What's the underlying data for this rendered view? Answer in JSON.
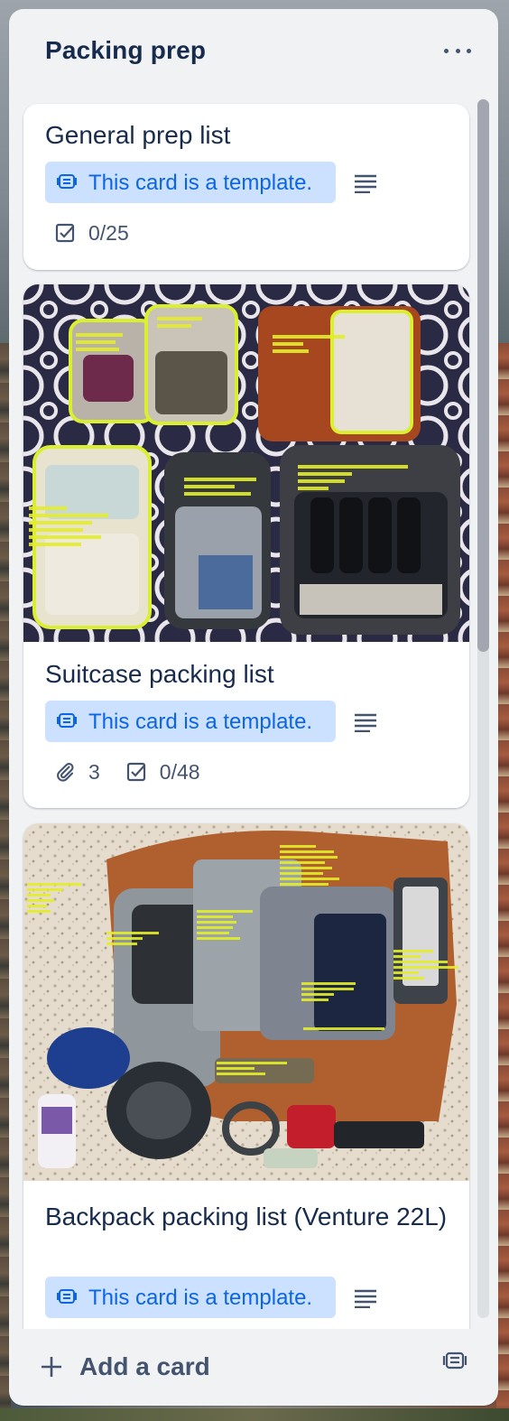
{
  "list": {
    "title": "Packing prep",
    "menu_icon": "more-horizontal-icon"
  },
  "cards": [
    {
      "title": "General prep list",
      "template_label": "This card is a template.",
      "checklist": "0/25"
    },
    {
      "title": "Suitcase packing list",
      "template_label": "This card is a template.",
      "attachments": "3",
      "checklist": "0/48",
      "cover": {
        "labels": [
          "M packing cube",
          "M compression cube",
          "L compression cube",
          "S compression cube (outerwear)",
          "M compression cube (skinwear)",
          "toiletries"
        ]
      }
    },
    {
      "title": "Backpack packing list (Venture 22L)",
      "template_label": "This card is a template.",
      "cover": {
        "labels": [
          "Main compartment",
          "Laptop sleeve",
          "side pocket (long items)",
          "zipped mesh pocket"
        ]
      }
    }
  ],
  "footer": {
    "add_card_label": "Add a card",
    "add_icon": "plus-icon",
    "template_icon": "card-template-icon"
  },
  "colors": {
    "list_bg": "#f1f2f4",
    "card_bg": "#ffffff",
    "template_badge_bg": "#cce0ff",
    "template_badge_text": "#0c66e4",
    "text_primary": "#172b4d",
    "text_secondary": "#44546f"
  }
}
